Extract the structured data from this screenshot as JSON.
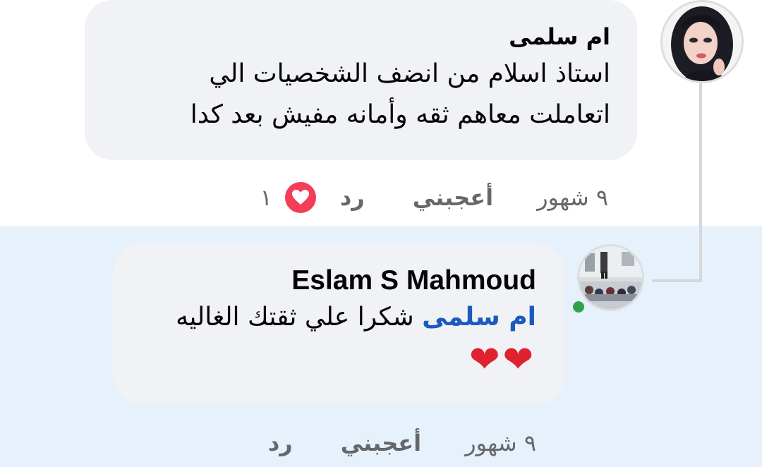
{
  "comment": {
    "author": "ام سلمى",
    "text_line_1": "استاذ اسلام من انضف الشخصيات الي",
    "text_line_2": "اتعاملت معاهم ثقه وأمانه مفيش بعد كدا",
    "time": "٩ شهور",
    "like_label": "أعجبني",
    "reply_label": "رد",
    "reaction_count": "١",
    "reaction_icon": "heart-icon"
  },
  "reply": {
    "author": "Eslam S Mahmoud",
    "mention": "ام سلمى",
    "text": "شكرا علي ثقتك الغاليه",
    "emojis": "❤❤",
    "time": "٩ شهور",
    "like_label": "أعجبني",
    "reply_label": "رد",
    "online": true
  },
  "colors": {
    "bubble": "#f0f2f5",
    "highlight": "#e7f1fc",
    "mention": "#1b5bbd",
    "meta_text": "#65676b",
    "love_reaction": "#f33e58",
    "online": "#31a24c"
  }
}
